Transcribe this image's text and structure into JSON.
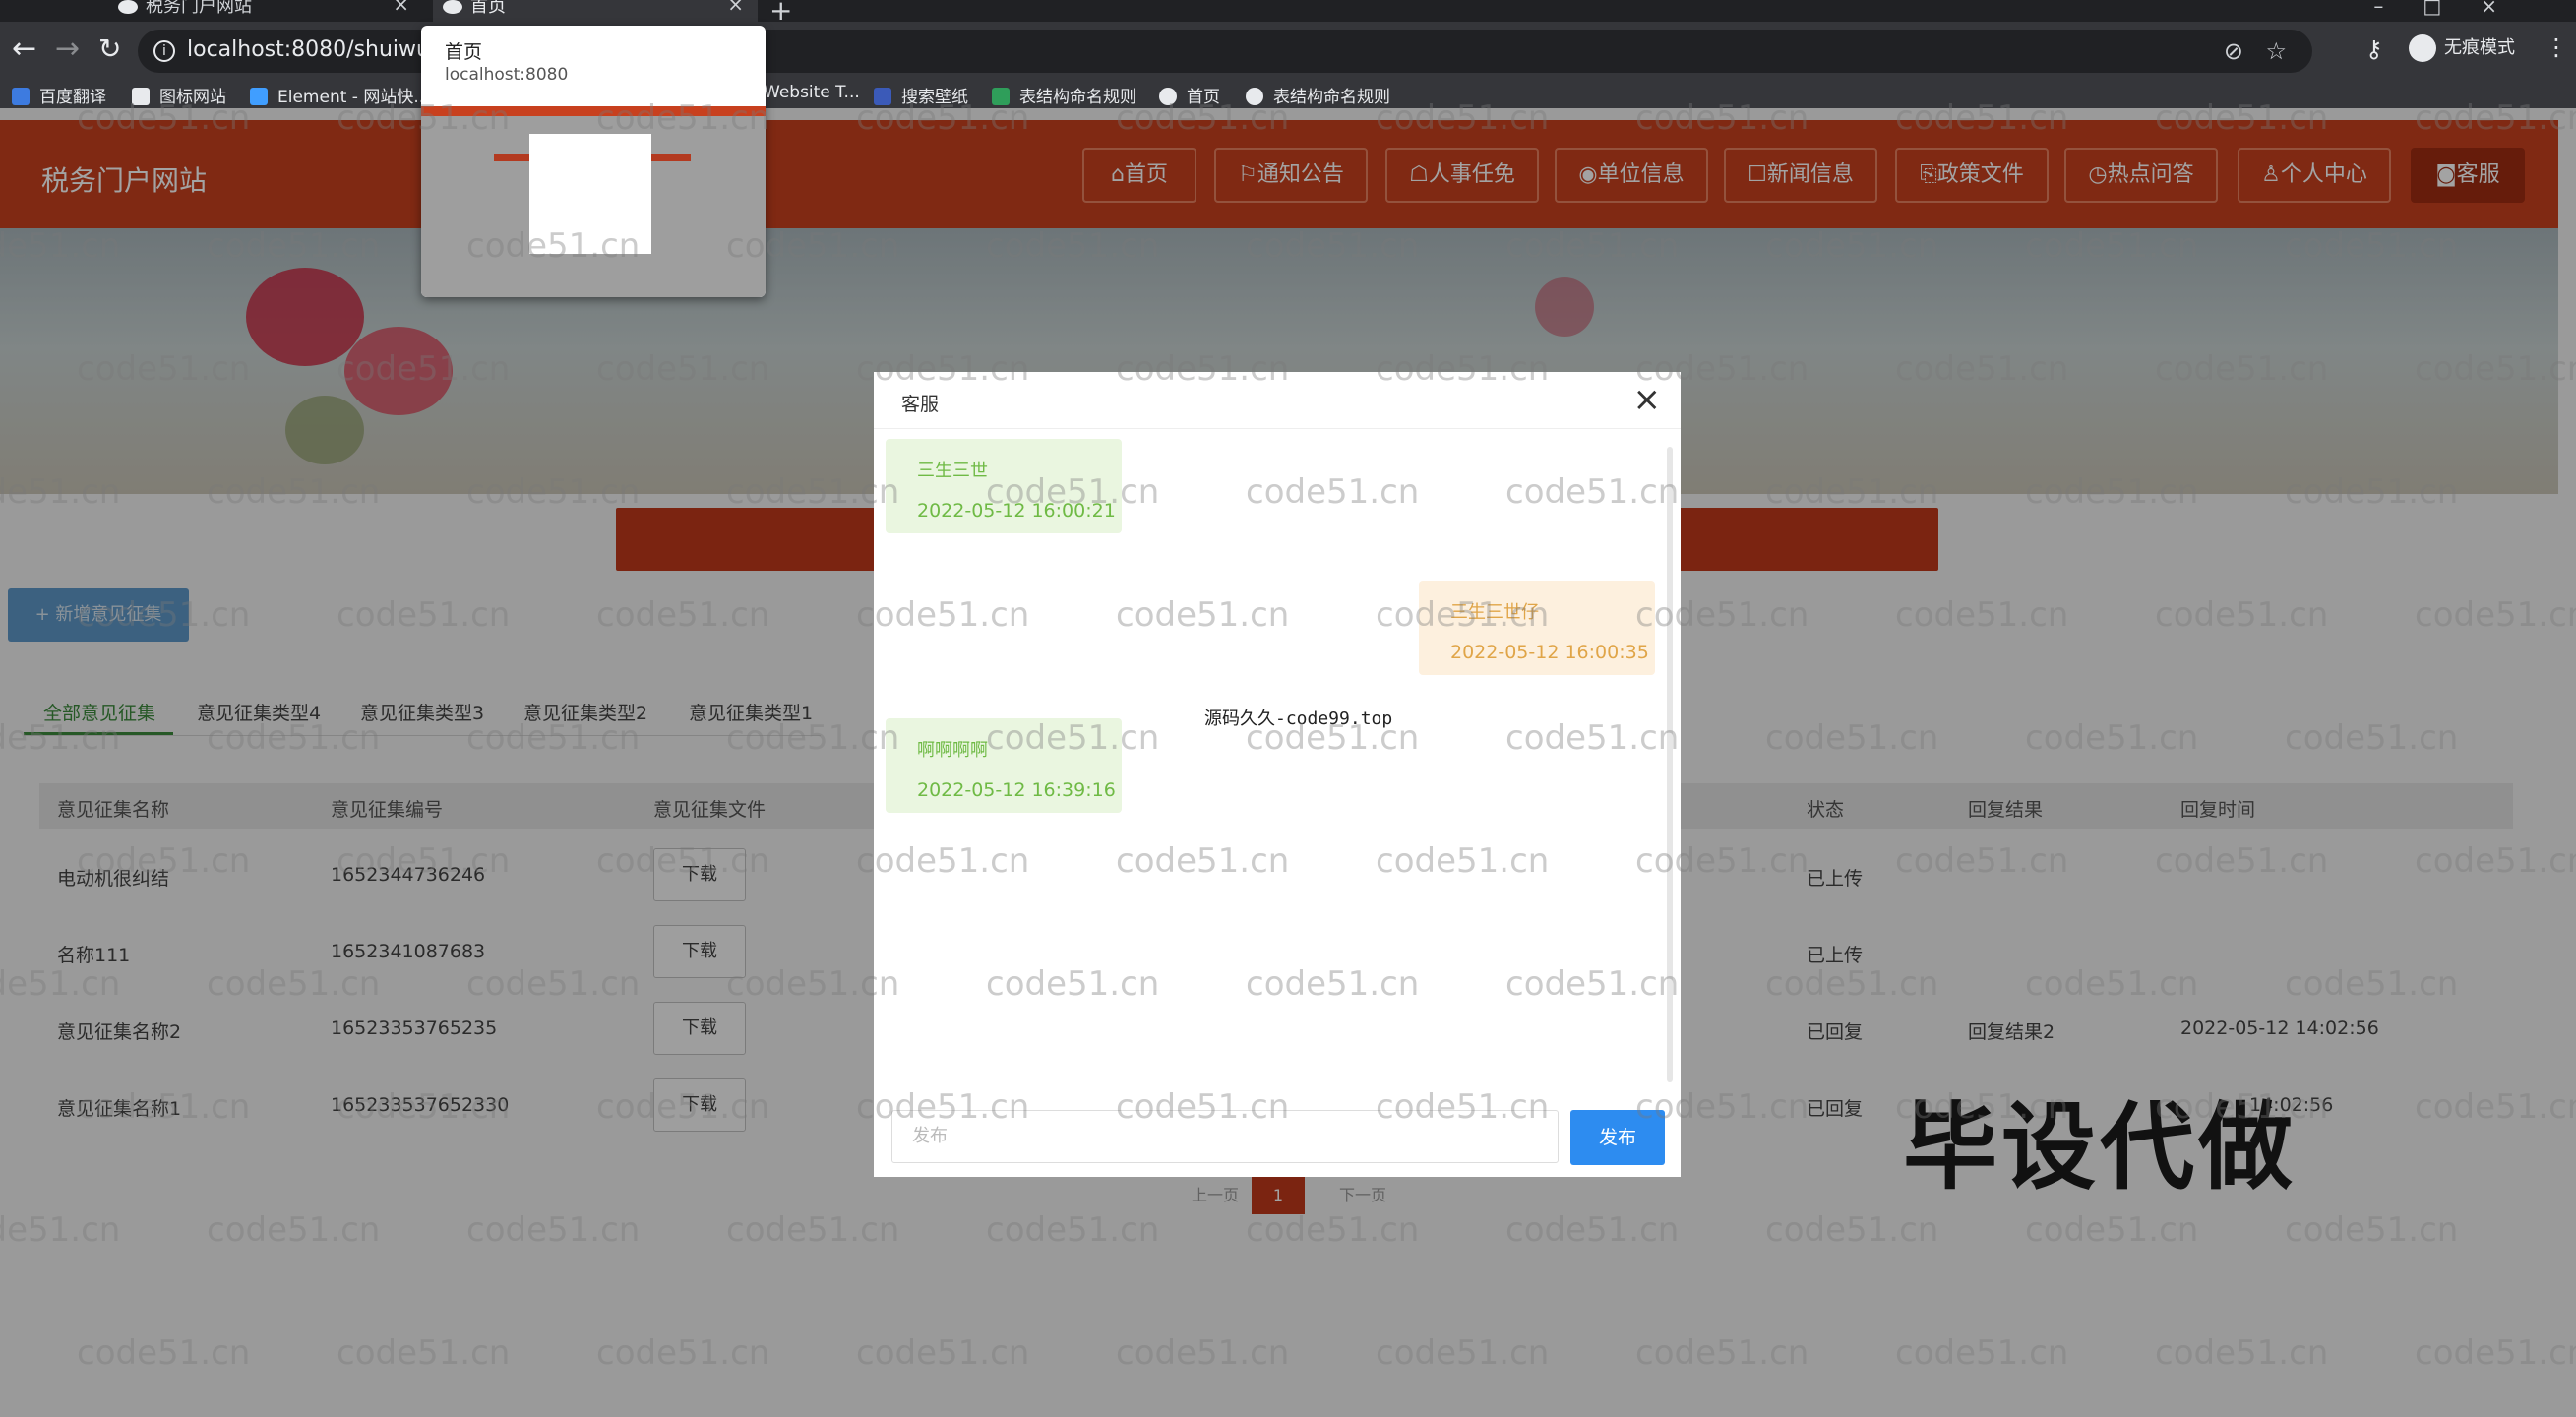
{
  "browser": {
    "tabs": [
      {
        "label": "税务门户网站"
      },
      {
        "label": "首页"
      }
    ],
    "url": "localhost:8080/shuiwume",
    "profile_label": "无痕模式",
    "bookmarks": [
      "百度翻译",
      "图标网站",
      "Element - 网站快...",
      "Website T...",
      "搜索壁纸",
      "表结构命名规则",
      "首页",
      "表结构命名规则"
    ],
    "tab_preview": {
      "title": "首页",
      "url": "localhost:8080"
    }
  },
  "site": {
    "title": "税务门户网站",
    "nav": [
      "首页",
      "通知公告",
      "人事任免",
      "单位信息",
      "新闻信息",
      "政策文件",
      "热点问答",
      "个人中心",
      "客服"
    ]
  },
  "main": {
    "add_button": "+ 新增意见征集",
    "filter_tabs": [
      "全部意见征集",
      "意见征集类型4",
      "意见征集类型3",
      "意见征集类型2",
      "意见征集类型1"
    ],
    "columns": [
      "意见征集名称",
      "意见征集编号",
      "意见征集文件",
      "状态",
      "回复结果",
      "回复时间"
    ],
    "rows": [
      {
        "name": "电动机很纠结",
        "code": "1652344736246",
        "file": "下载",
        "status": "已上传",
        "reply": "",
        "time": ""
      },
      {
        "name": "名称111",
        "code": "1652341087683",
        "file": "下载",
        "status": "已上传",
        "reply": "",
        "time": ""
      },
      {
        "name": "意见征集名称2",
        "code": "16523353765235",
        "file": "下载",
        "status": "已回复",
        "reply": "回复结果2",
        "time": "2022-05-12 14:02:56"
      },
      {
        "name": "意见征集名称1",
        "code": "165233537652330",
        "file": "下载",
        "status": "已回复",
        "reply": "",
        "time": "14:02:56"
      }
    ],
    "pager": {
      "prev": "上一页",
      "current": "1",
      "next": "下一页"
    }
  },
  "dialog": {
    "title": "客服",
    "close": "×",
    "messages": [
      {
        "side": "left",
        "text": "三生三世",
        "time": "2022-05-12 16:00:21"
      },
      {
        "side": "right",
        "text": "三生三世仔",
        "time": "2022-05-12 16:00:35"
      },
      {
        "side": "left",
        "text": "啊啊啊啊",
        "time": "2022-05-12 16:39:16"
      }
    ],
    "center_watermark": "源码久久-code99.top",
    "input_placeholder": "发布",
    "send_label": "发布"
  },
  "overlay_text": "毕设代做",
  "watermark_text": "code51.cn",
  "colors": {
    "brand": "#c8401e",
    "send": "#2d8cf0",
    "tab_active": "#3c8a3c"
  }
}
